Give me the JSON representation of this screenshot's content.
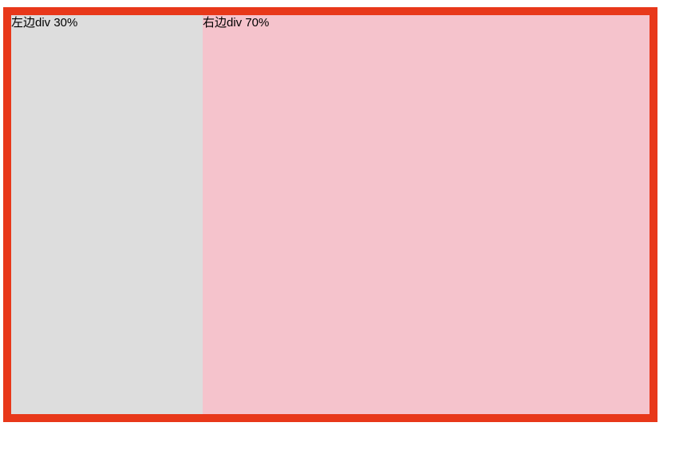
{
  "colors": {
    "border": "#e8381a",
    "left_background": "#dddddd",
    "right_background": "#f5c3cc",
    "page_background": "#ffffff"
  },
  "panels": {
    "left": {
      "label": "左边div 30%"
    },
    "right": {
      "label": "右边div 70%"
    }
  }
}
